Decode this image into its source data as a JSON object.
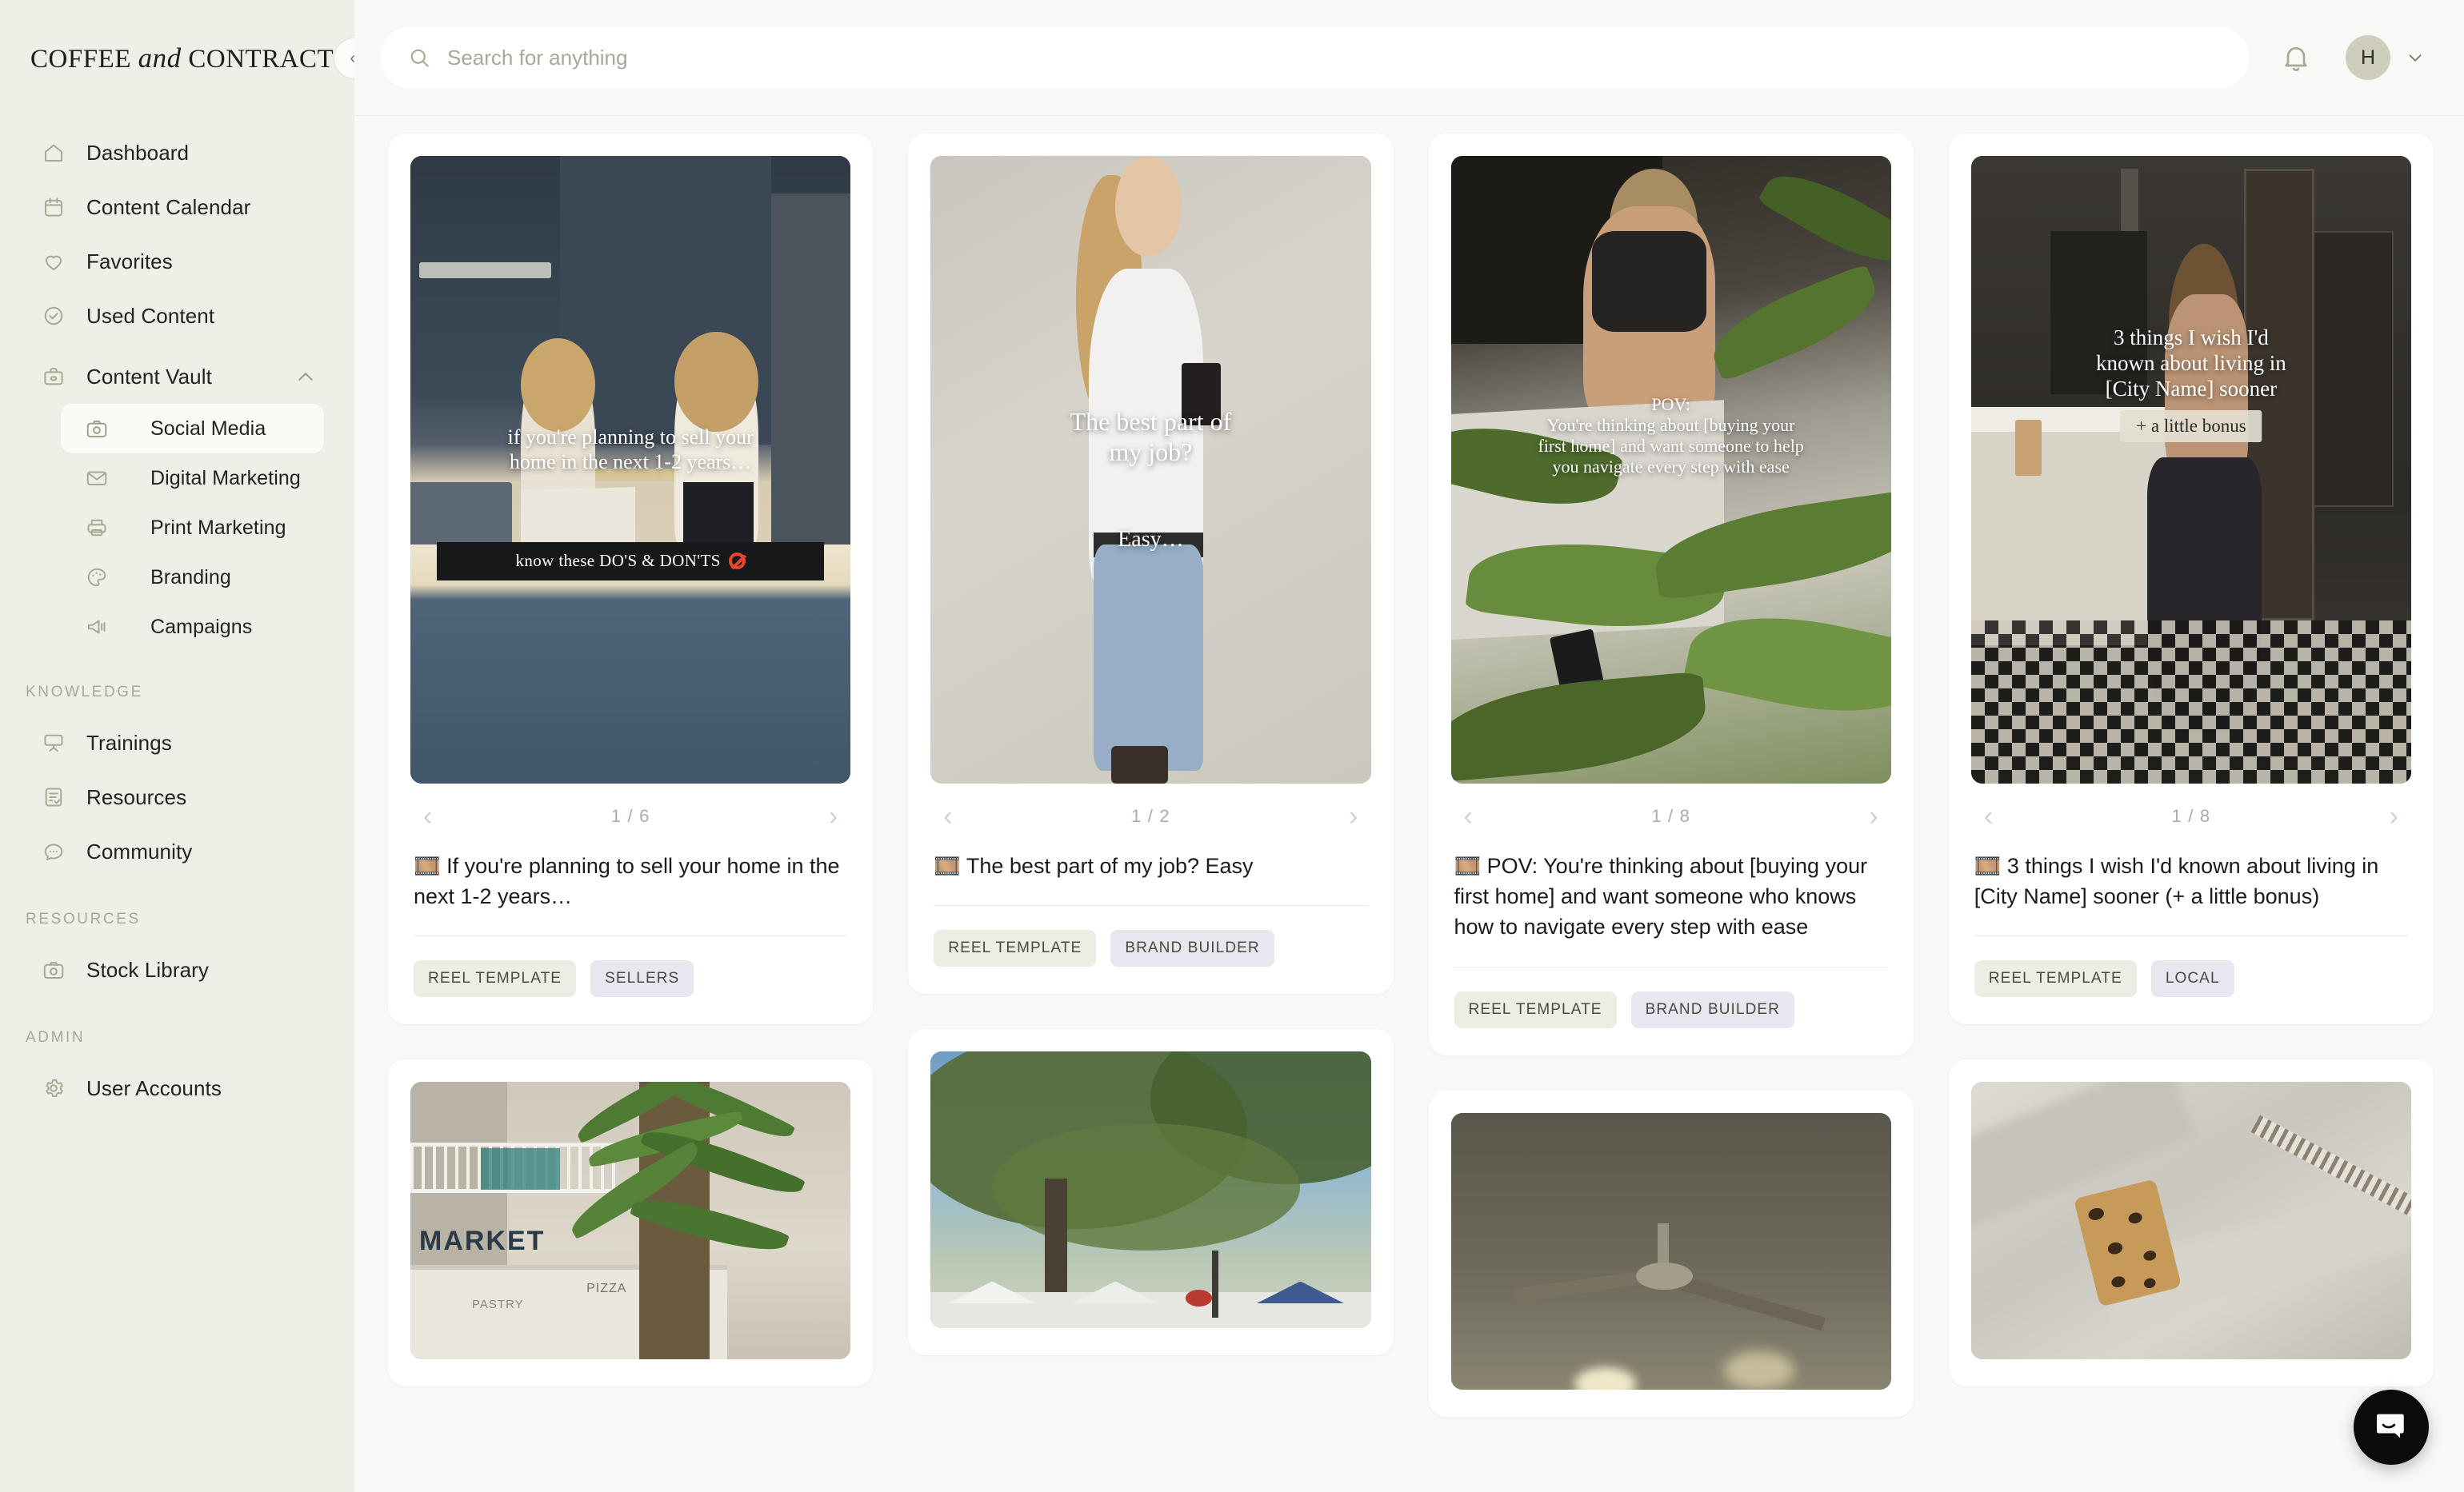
{
  "brand": {
    "part1": "COFFEE ",
    "italic": "and",
    "part2": " CONTRACTS",
    "collapse_label": "«"
  },
  "topbar": {
    "search_placeholder": "Search for anything",
    "search_value": "",
    "search_icon": "search-icon",
    "bell_icon": "bell-icon",
    "avatar_initial": "H",
    "chevron": "⌄"
  },
  "sidebar": {
    "primary": [
      {
        "label": "Dashboard",
        "icon": "home-icon"
      },
      {
        "label": "Content Calendar",
        "icon": "calendar-icon"
      },
      {
        "label": "Favorites",
        "icon": "heart-icon"
      },
      {
        "label": "Used Content",
        "icon": "check-circle-icon"
      },
      {
        "label": "Content Vault",
        "icon": "briefcase-icon",
        "expanded": true
      }
    ],
    "vault_children": [
      {
        "label": "Social Media",
        "icon": "camera-icon",
        "active": true
      },
      {
        "label": "Digital Marketing",
        "icon": "envelope-icon",
        "active": false
      },
      {
        "label": "Print Marketing",
        "icon": "printer-icon",
        "active": false
      },
      {
        "label": "Branding",
        "icon": "palette-icon",
        "active": false
      },
      {
        "label": "Campaigns",
        "icon": "megaphone-icon",
        "active": false
      }
    ],
    "knowledge_heading": "KNOWLEDGE",
    "knowledge": [
      {
        "label": "Trainings",
        "icon": "presentation-icon"
      },
      {
        "label": "Resources",
        "icon": "document-check-icon"
      },
      {
        "label": "Community",
        "icon": "chat-bubble-icon"
      }
    ],
    "resources_heading": "RESOURCES",
    "resources": [
      {
        "label": "Stock Library",
        "icon": "camera-icon"
      }
    ],
    "admin_heading": "ADMIN",
    "admin": [
      {
        "label": "User Accounts",
        "icon": "gear-icon"
      }
    ]
  },
  "colors": {
    "sidebar_bg": "#EFEFE7",
    "page_bg": "#F8F8F6",
    "card_bg": "#FFFFFF",
    "tag_beige": "#EDEDE3",
    "tag_lilac": "#E8E6EE",
    "avatar_bg": "#CFCEBD",
    "muted_text": "#A9A894"
  },
  "cards": [
    {
      "id": "sell-home-1-2-years",
      "counter": "1 / 6",
      "prev": "‹",
      "next": "›",
      "title": "🎞️ If you're planning to sell your home in the next 1-2 years…",
      "tags": [
        {
          "label": "REEL TEMPLATE",
          "style": "beige"
        },
        {
          "label": "SELLERS",
          "style": "lilac"
        }
      ],
      "overlay_lines": [
        "if you're planning to sell your",
        "home in the next 1-2 years…"
      ],
      "overlay_bar": "know these DO'S & DON'TS"
    },
    {
      "id": "best-part-of-my-job",
      "counter": "1 / 2",
      "prev": "‹",
      "next": "›",
      "title": "🎞️ The best part of my job? Easy",
      "tags": [
        {
          "label": "REEL TEMPLATE",
          "style": "beige"
        },
        {
          "label": "BRAND BUILDER",
          "style": "lilac"
        }
      ],
      "overlay_lines": [
        "The best part of",
        "my job?"
      ],
      "overlay_sub": "Easy…"
    },
    {
      "id": "pov-first-home",
      "counter": "1 / 8",
      "prev": "‹",
      "next": "›",
      "title": "🎞️ POV: You're thinking about [buying your first home] and want someone who knows how to navigate every step with ease",
      "tags": [
        {
          "label": "REEL TEMPLATE",
          "style": "beige"
        },
        {
          "label": "BRAND BUILDER",
          "style": "lilac"
        }
      ],
      "overlay_lines": [
        "POV:",
        "You're thinking about [buying your",
        "first home] and want someone to help",
        "you navigate every step with ease"
      ]
    },
    {
      "id": "3-things-city-name",
      "counter": "1 / 8",
      "prev": "‹",
      "next": "›",
      "title": "🎞️ 3 things I wish I'd known about living in [City Name] sooner (+ a little bonus)",
      "tags": [
        {
          "label": "REEL TEMPLATE",
          "style": "beige"
        },
        {
          "label": "LOCAL",
          "style": "lilac"
        }
      ],
      "overlay_lines": [
        "3 things I wish I'd",
        "known about living in",
        "[City Name] sooner"
      ],
      "overlay_pill": "+ a little bonus"
    }
  ],
  "row2": [
    {
      "id": "market-building",
      "scene": "market"
    },
    {
      "id": "outdoor-market-trees",
      "scene": "outdoor"
    },
    {
      "id": "ceiling-fan",
      "scene": "fan"
    },
    {
      "id": "phone-on-bed",
      "scene": "bed"
    }
  ],
  "chat_widget": {
    "icon": "chat-bubble-icon",
    "label": "Open chat"
  }
}
